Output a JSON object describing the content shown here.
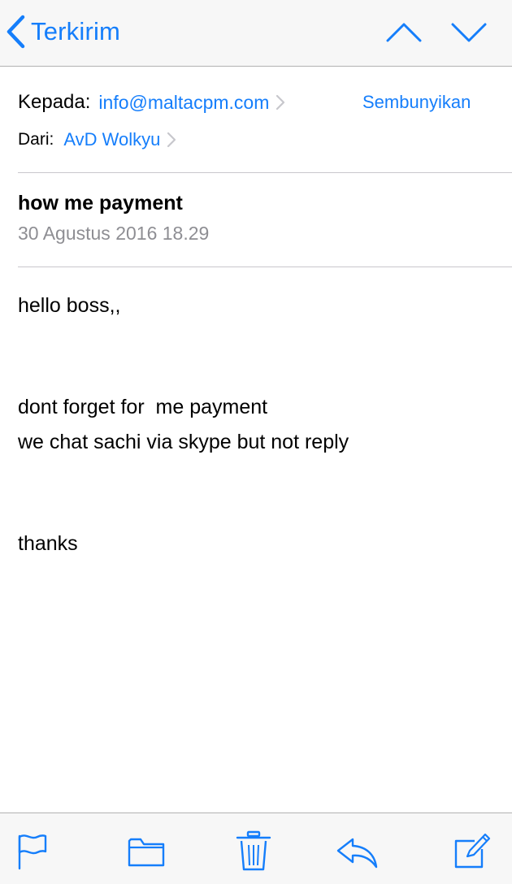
{
  "navbar": {
    "back_label": "Terkirim",
    "icons": {
      "back": "chevron-left-icon",
      "prev": "chevron-up-icon",
      "next": "chevron-down-icon"
    }
  },
  "header": {
    "to_label": "Kepada:",
    "to_address": "info@maltacpm.com",
    "hide_label": "Sembunyikan",
    "from_label": "Dari:",
    "from_name": "AvD Wolkyu"
  },
  "message": {
    "subject": "how me payment",
    "date": "30 Agustus 2016 18.29",
    "body": [
      "hello boss,,",
      "dont forget for  me payment",
      "we chat sachi via skype but not reply",
      "thanks"
    ]
  },
  "toolbar": {
    "icons": [
      "flag-icon",
      "folder-icon",
      "trash-icon",
      "reply-icon",
      "compose-icon"
    ]
  },
  "colors": {
    "accent": "#157efb",
    "secondary_text": "#8e8e93",
    "bar_background": "#f7f7f7",
    "separator": "#c8c7cc"
  }
}
